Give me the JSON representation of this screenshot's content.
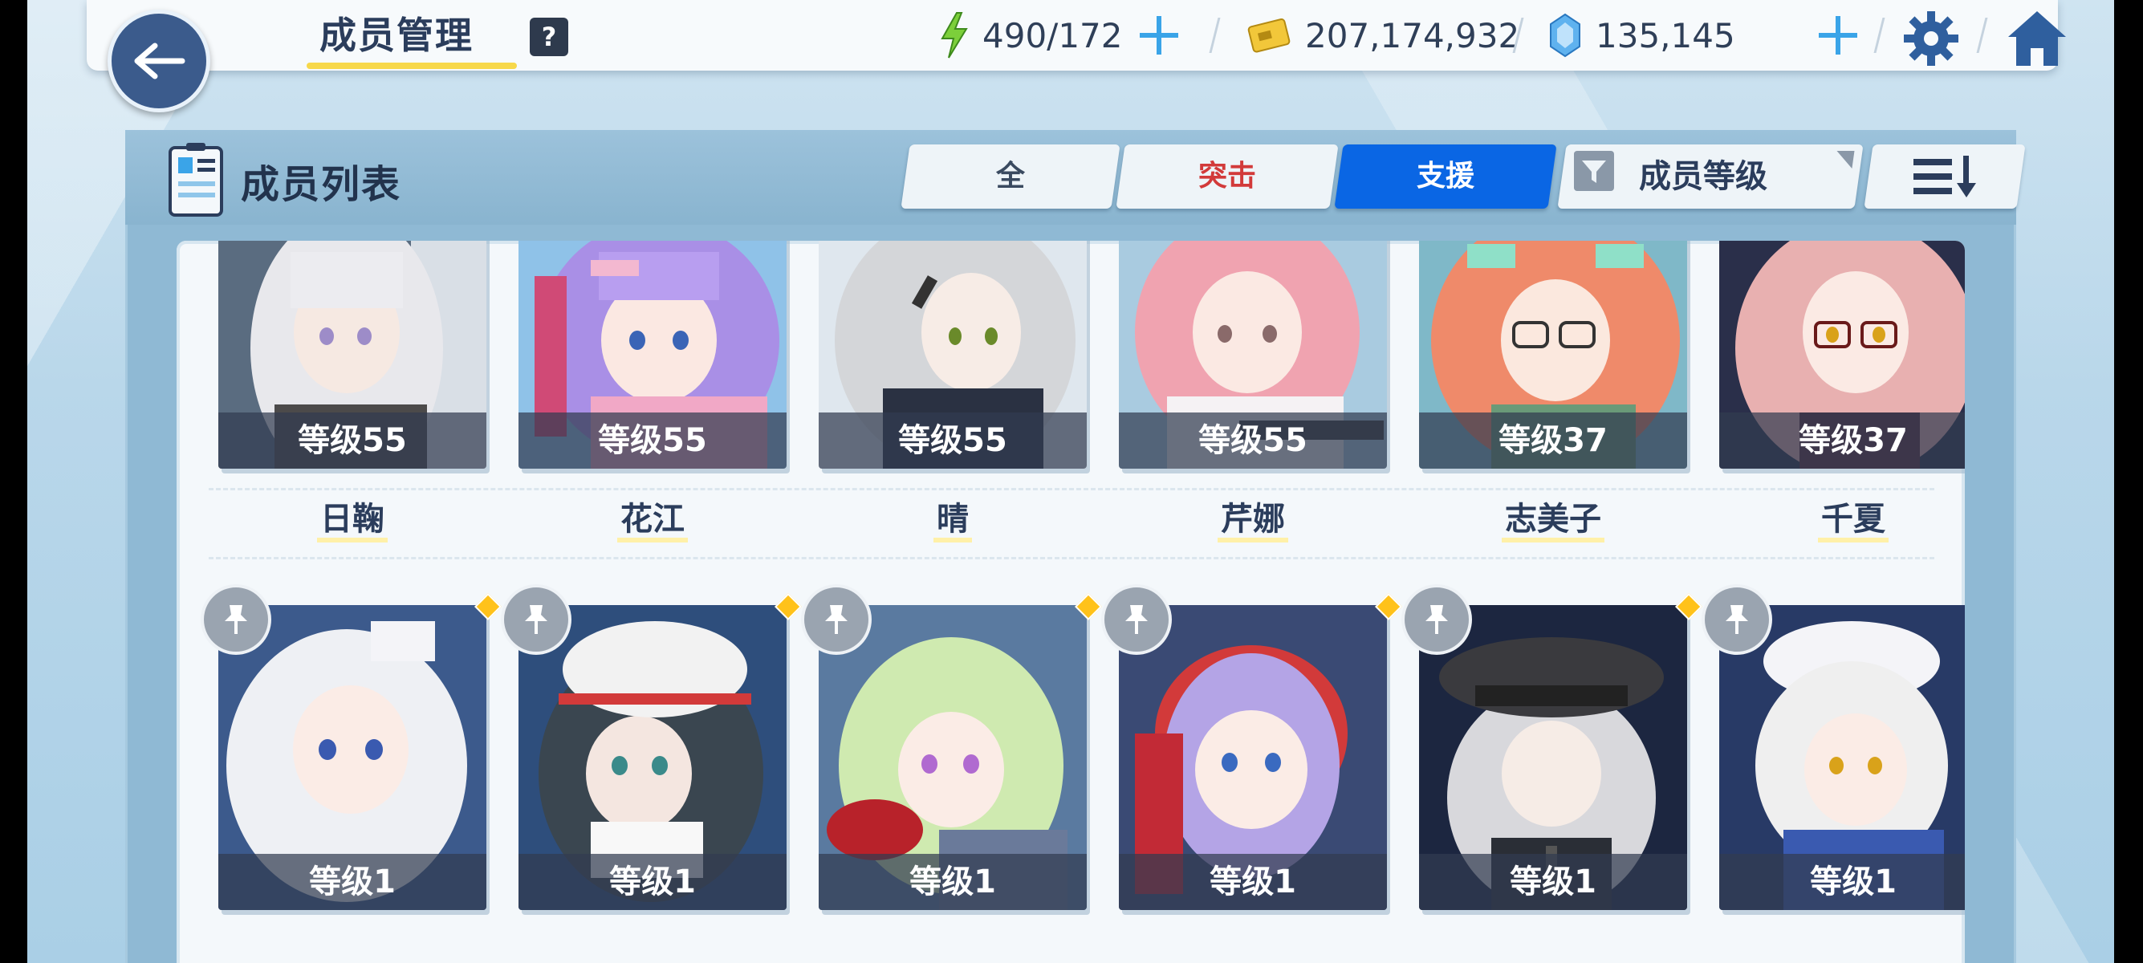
{
  "header": {
    "title": "成员管理",
    "help": "?",
    "energy": "490/172",
    "credits": "207,174,932",
    "gems": "135,145"
  },
  "panel": {
    "title": "成员列表",
    "tabs": [
      "全",
      "突击",
      "支援"
    ],
    "sort_label": "成员等级"
  },
  "colors": {
    "active_tab": "#0a66e4",
    "assault_text": "#d23a3a",
    "level_bar": "#323c50",
    "accent_dot": "#ffc21a"
  },
  "row1": [
    {
      "level": "等级55",
      "name": "日鞠"
    },
    {
      "level": "等级55",
      "name": "花江"
    },
    {
      "level": "等级55",
      "name": "晴"
    },
    {
      "level": "等级55",
      "name": "芹娜"
    },
    {
      "level": "等级37",
      "name": "志美子"
    },
    {
      "level": "等级37",
      "name": "千夏"
    }
  ],
  "row2": [
    {
      "level": "等级1"
    },
    {
      "level": "等级1"
    },
    {
      "level": "等级1"
    },
    {
      "level": "等级1"
    },
    {
      "level": "等级1"
    },
    {
      "level": "等级1"
    }
  ]
}
